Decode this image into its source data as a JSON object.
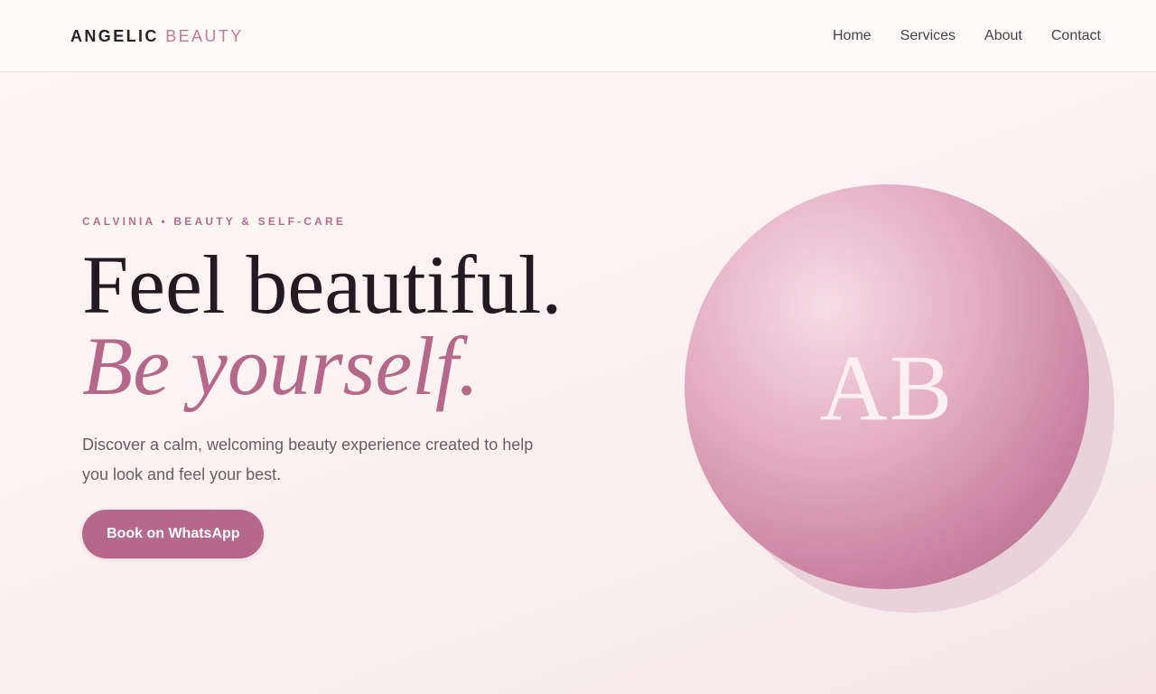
{
  "header": {
    "brand_first": "ANGELIC",
    "brand_second": "BEAUTY",
    "nav": [
      {
        "label": "Home"
      },
      {
        "label": "Services"
      },
      {
        "label": "About"
      },
      {
        "label": "Contact"
      }
    ]
  },
  "hero": {
    "eyebrow": "CALVINIA • BEAUTY & SELF-CARE",
    "headline_line1": "Feel beautiful.",
    "headline_line2": "Be yourself.",
    "description": "Discover a calm, welcoming beauty experience created to help you look and feel your best.",
    "cta_label": "Book on WhatsApp",
    "monogram": "AB"
  },
  "colors": {
    "accent": "#b5688a",
    "heading": "#221b21",
    "text_muted": "#6b5d64"
  }
}
